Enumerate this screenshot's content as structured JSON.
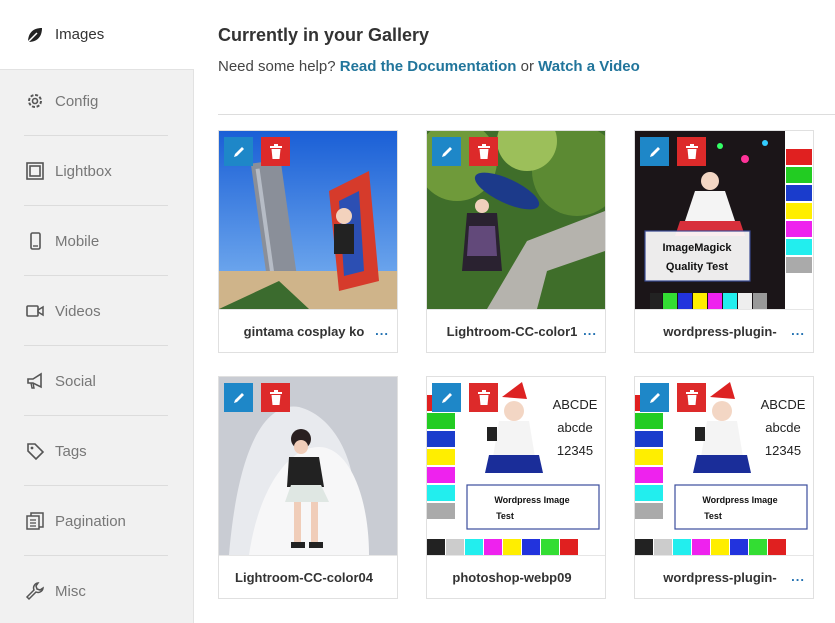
{
  "sidebar": {
    "items": [
      {
        "label": "Images",
        "icon": "leaf-icon"
      },
      {
        "label": "Config",
        "icon": "gear-icon"
      },
      {
        "label": "Lightbox",
        "icon": "lightbox-icon"
      },
      {
        "label": "Mobile",
        "icon": "mobile-icon"
      },
      {
        "label": "Videos",
        "icon": "video-camera-icon"
      },
      {
        "label": "Social",
        "icon": "megaphone-icon"
      },
      {
        "label": "Tags",
        "icon": "tags-icon"
      },
      {
        "label": "Pagination",
        "icon": "pagination-icon"
      },
      {
        "label": "Misc",
        "icon": "wrench-icon"
      }
    ]
  },
  "main": {
    "title": "Currently in your Gallery",
    "help_prefix": "Need some help?",
    "doc_link": "Read the Documentation",
    "or_text": "or",
    "video_link": "Watch a Video"
  },
  "gallery": [
    {
      "caption": "gintama cosplay ko",
      "more": "..."
    },
    {
      "caption": "Lightroom-CC-color1",
      "more": "..."
    },
    {
      "caption": "wordpress-plugin-",
      "more": "..."
    },
    {
      "caption": "Lightroom-CC-color04",
      "more": ""
    },
    {
      "caption": "photoshop-webp09",
      "more": ""
    },
    {
      "caption": "wordpress-plugin-",
      "more": "..."
    }
  ],
  "thumb_text": {
    "imagemagick_line1": "ImageMagick",
    "imagemagick_line2": "Quality Test",
    "abc_upper": "ABCDE",
    "abc_lower": "abcde",
    "digits": "12345",
    "wp_line1": "Wordpress Image",
    "wp_line2": "Test"
  },
  "colors": {
    "edit_button": "#1e87c8",
    "delete_button": "#dd2a2a",
    "link": "#21759b"
  }
}
